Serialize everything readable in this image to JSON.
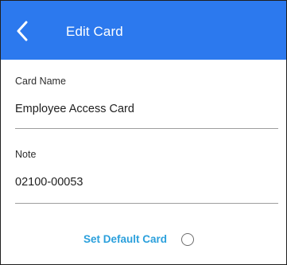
{
  "header": {
    "title": "Edit Card",
    "back_icon": "chevron-left-icon",
    "background_color": "#2c79ee"
  },
  "form": {
    "card_name": {
      "label": "Card Name",
      "value": "Employee Access Card"
    },
    "note": {
      "label": "Note",
      "value": "02100-00053"
    },
    "default_card": {
      "label": "Set Default Card",
      "checked": false,
      "label_color": "#2ba0dc"
    }
  }
}
